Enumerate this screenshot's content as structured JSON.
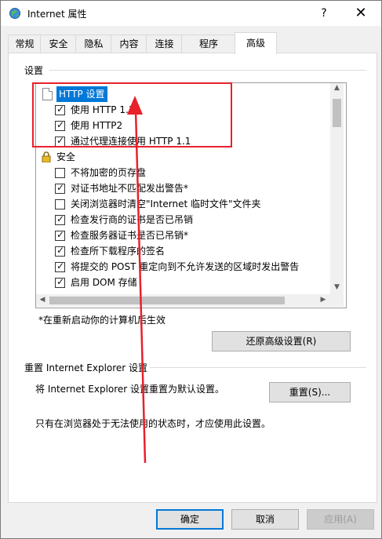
{
  "window": {
    "title": "Internet 属性",
    "help_label": "?",
    "close_label": "✕"
  },
  "tabs": [
    {
      "label": "常规"
    },
    {
      "label": "安全"
    },
    {
      "label": "隐私"
    },
    {
      "label": "内容"
    },
    {
      "label": "连接"
    },
    {
      "label": "程序"
    },
    {
      "label": "高级",
      "active": true
    }
  ],
  "settings": {
    "group_label": "设置",
    "http_header": "HTTP 设置",
    "http_items": [
      {
        "label": "使用 HTTP 1.1",
        "checked": true
      },
      {
        "label": "使用 HTTP2",
        "checked": true
      },
      {
        "label": "通过代理连接使用 HTTP 1.1",
        "checked": true
      }
    ],
    "security_header": "安全",
    "security_items": [
      {
        "label": "不将加密的页存盘",
        "checked": false
      },
      {
        "label": "对证书地址不匹配发出警告*",
        "checked": true
      },
      {
        "label": "关闭浏览器时清空\"Internet 临时文件\"文件夹",
        "checked": false
      },
      {
        "label": "检查发行商的证书是否已吊销",
        "checked": true
      },
      {
        "label": "检查服务器证书是否已吊销*",
        "checked": true
      },
      {
        "label": "检查所下载程序的签名",
        "checked": true
      },
      {
        "label": "将提交的 POST 重定向到不允许发送的区域时发出警告",
        "checked": true
      },
      {
        "label": "启用 DOM 存储",
        "checked": true
      }
    ],
    "note": "*在重新启动你的计算机后生效",
    "restore_button": "还原高级设置(R)"
  },
  "reset": {
    "group_label": "重置 Internet Explorer 设置",
    "description": "将 Internet Explorer 设置重置为默认设置。",
    "reset_button": "重置(S)...",
    "info": "只有在浏览器处于无法使用的状态时，才应使用此设置。"
  },
  "footer": {
    "ok": "确定",
    "cancel": "取消",
    "apply": "应用(A)"
  },
  "annotation": {
    "color": "#e8212b"
  }
}
